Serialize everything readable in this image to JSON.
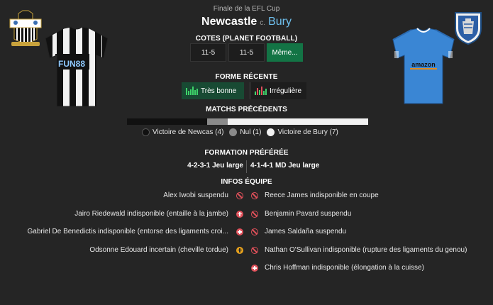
{
  "header": {
    "competition": "Finale de la EFL Cup",
    "home_team": "Newcastle",
    "vs": "c.",
    "away_team": "Bury"
  },
  "odds": {
    "title": "COTES (PLANET FOOTBALL)",
    "home": "11-5",
    "away": "11-5",
    "more_label": "Même..."
  },
  "recent_form": {
    "title": "FORME RÉCENTE",
    "home": "Très bonne",
    "away": "Irrégulière"
  },
  "head_to_head": {
    "title": "MATCHS PRÉCÉDENTS",
    "home_wins": 4,
    "draws": 1,
    "away_wins": 7,
    "home_label": "Victoire de Newcas (4)",
    "draw_label": "Nul (1)",
    "away_label": "Victoire de Bury (7)"
  },
  "formation": {
    "title": "FORMATION PRÉFÉRÉE",
    "home": "4-2-3-1 Jeu large",
    "away": "4-1-4-1 MD Jeu large"
  },
  "team_news": {
    "title": "INFOS ÉQUIPE",
    "home": [
      {
        "text": "Alex Iwobi suspendu",
        "status": "suspended"
      },
      {
        "text": "Jairo Riedewald indisponible (entaille à la jambe)",
        "status": "injured"
      },
      {
        "text": "Gabriel De Benedictis indisponible (entorse des ligaments croi...",
        "status": "injured"
      },
      {
        "text": "Odsonne Edouard incertain (cheville tordue)",
        "status": "doubtful"
      }
    ],
    "away": [
      {
        "text": "Reece James indisponible en coupe",
        "status": "suspended"
      },
      {
        "text": "Benjamin Pavard suspendu",
        "status": "suspended"
      },
      {
        "text": "James Saldaña suspendu",
        "status": "suspended"
      },
      {
        "text": "Nathan O'Sullivan indisponible (rupture des ligaments du genou)",
        "status": "suspended"
      },
      {
        "text": "Chris Hoffman indisponible (élongation à la cuisse)",
        "status": "injured"
      }
    ]
  },
  "kits": {
    "home_sponsor": "FUN88",
    "away_sponsor": "amazon"
  },
  "colors": {
    "accent_green": "#137445",
    "away_blue": "#6fc0ee",
    "injury_red": "#e0505a",
    "doubt_yellow": "#e8a21c"
  }
}
